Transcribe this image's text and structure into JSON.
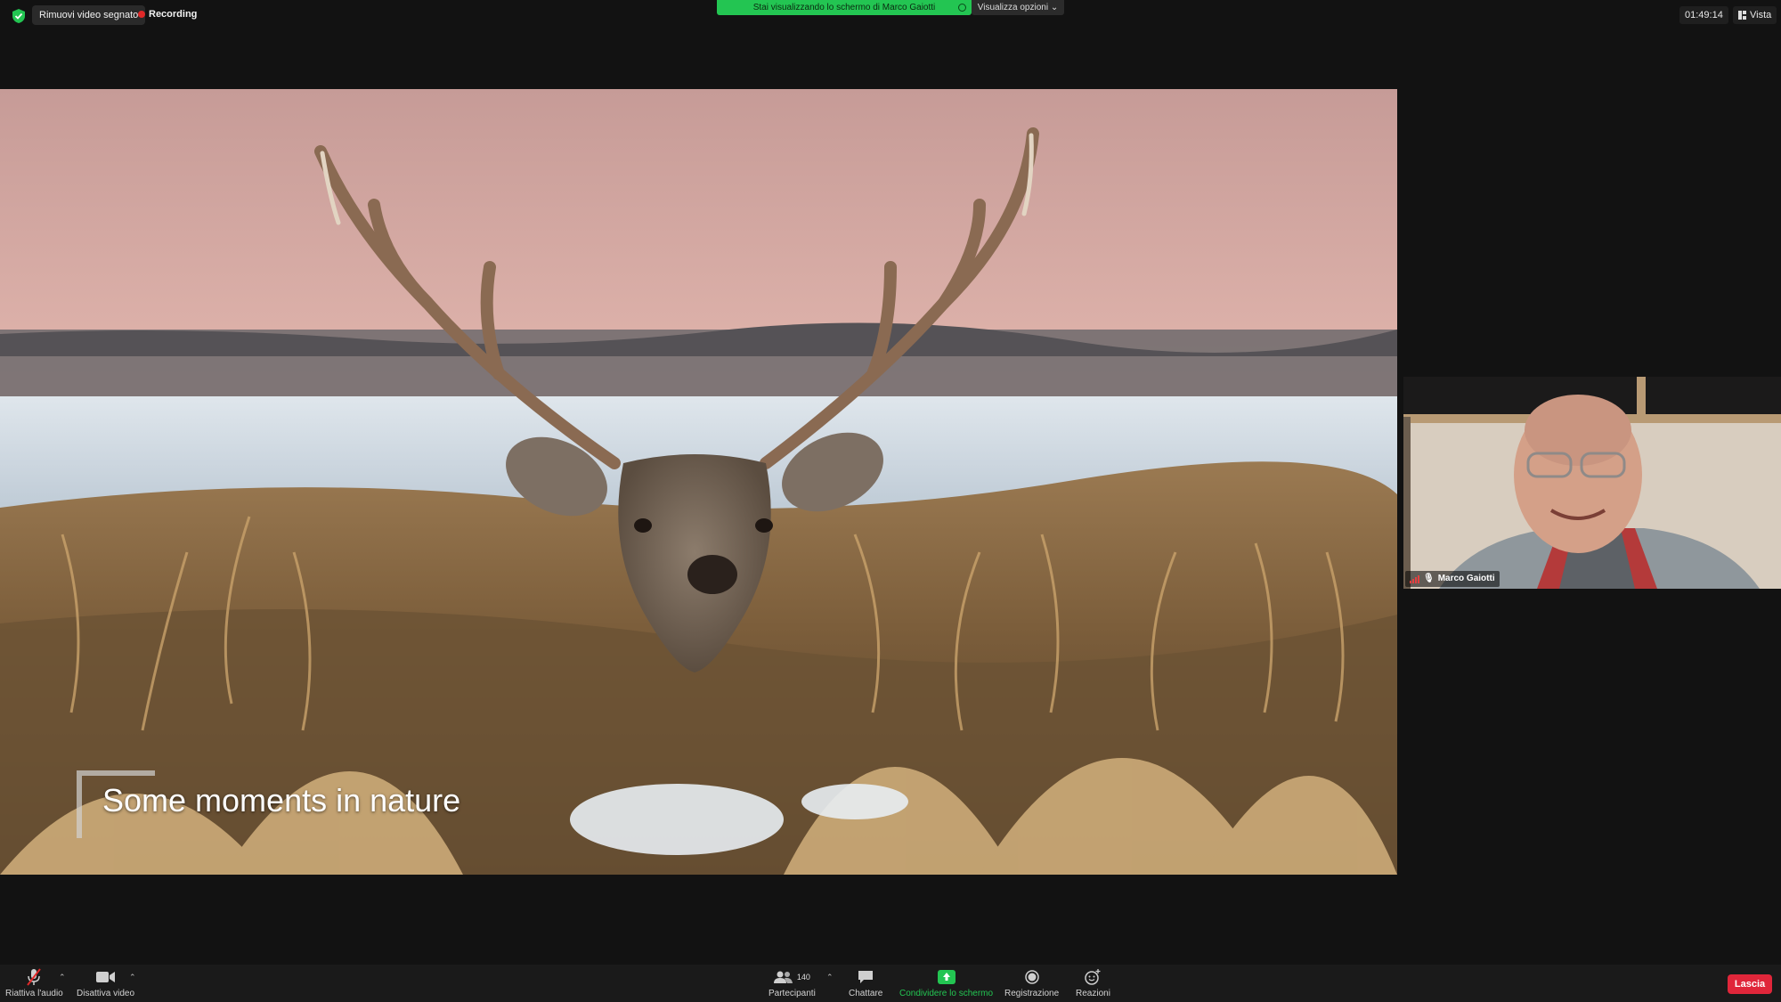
{
  "topbar": {
    "remove_video_label": "Rimuovi video segnato",
    "recording_label": "Recording",
    "share_banner_text": "Stai visualizzando lo schermo di Marco Gaiotti",
    "view_options_label": "Visualizza opzioni",
    "clock": "01:49:14",
    "view_label": "Vista"
  },
  "shared_screen": {
    "slide_title": "Some moments in nature"
  },
  "participant": {
    "name": "Marco Gaiotti"
  },
  "toolbar": {
    "unmute_label": "Riattiva l'audio",
    "stop_video_label": "Disattiva video",
    "participants_label": "Partecipanti",
    "participants_count": "140",
    "chat_label": "Chattare",
    "share_screen_label": "Condividere lo schermo",
    "record_label": "Registrazione",
    "reactions_label": "Reazioni",
    "leave_label": "Lascia"
  },
  "colors": {
    "accent_green": "#23c552",
    "leave_red": "#e0263a",
    "recording_red": "#e02828"
  }
}
